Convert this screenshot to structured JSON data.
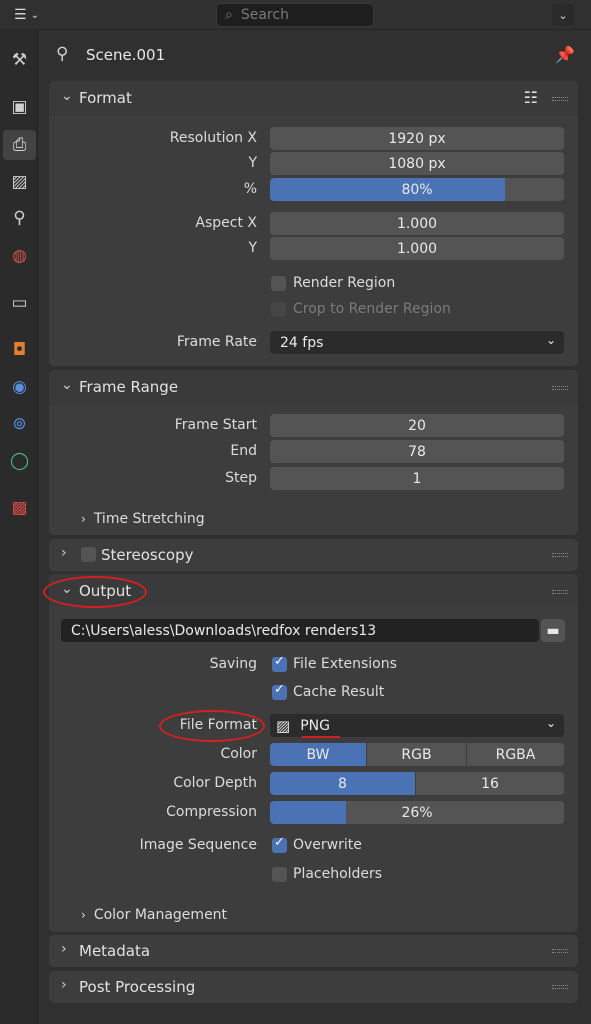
{
  "header": {
    "search_placeholder": "Search",
    "scene_name": "Scene.001"
  },
  "sidebar": {
    "tabs": [
      {
        "name": "tool-tab",
        "icon": "tool-icon"
      },
      {
        "name": "render-tab",
        "icon": "camera-back-icon"
      },
      {
        "name": "output-tab",
        "icon": "printer-icon",
        "active": true
      },
      {
        "name": "view-layer-tab",
        "icon": "image-icon"
      },
      {
        "name": "scene-tab",
        "icon": "scene-icon"
      },
      {
        "name": "world-tab",
        "icon": "world-icon"
      },
      {
        "name": "collection-tab",
        "icon": "box-icon"
      },
      {
        "name": "object-tab",
        "icon": "object-icon"
      },
      {
        "name": "modifiers-tab",
        "icon": "wrench-icon"
      },
      {
        "name": "particles-tab",
        "icon": "particles-icon"
      },
      {
        "name": "physics-tab",
        "icon": "physics-icon"
      },
      {
        "name": "texture-tab",
        "icon": "checker-icon"
      }
    ]
  },
  "format": {
    "title": "Format",
    "res_x_label": "Resolution X",
    "res_x": "1920 px",
    "res_y_label": "Y",
    "res_y": "1080 px",
    "pct_label": "%",
    "pct": "80%",
    "pct_fill": 0.8,
    "aspect_x_label": "Aspect X",
    "aspect_x": "1.000",
    "aspect_y_label": "Y",
    "aspect_y": "1.000",
    "render_region": "Render Region",
    "crop": "Crop to Render Region",
    "frame_rate_label": "Frame Rate",
    "frame_rate": "24 fps"
  },
  "frame_range": {
    "title": "Frame Range",
    "start_label": "Frame Start",
    "start": "20",
    "end_label": "End",
    "end": "78",
    "step_label": "Step",
    "step": "1",
    "time_stretching": "Time Stretching"
  },
  "stereoscopy": {
    "title": "Stereoscopy"
  },
  "output": {
    "title": "Output",
    "path": "C:\\Users\\aless\\Downloads\\redfox renders13",
    "saving_label": "Saving",
    "file_extensions": "File Extensions",
    "cache_result": "Cache Result",
    "file_format_label": "File Format",
    "file_format": "PNG",
    "color_label": "Color",
    "color_options": [
      "BW",
      "RGB",
      "RGBA"
    ],
    "color_selected": "BW",
    "depth_label": "Color Depth",
    "depth_options": [
      "8",
      "16"
    ],
    "depth_selected": "8",
    "compression_label": "Compression",
    "compression": "26%",
    "compression_fill": 0.26,
    "image_sequence_label": "Image Sequence",
    "overwrite": "Overwrite",
    "placeholders": "Placeholders",
    "color_management": "Color Management"
  },
  "metadata": {
    "title": "Metadata"
  },
  "post_processing": {
    "title": "Post Processing"
  },
  "colors": {
    "accent": "#4a72b5",
    "panel": "#3d3d3d",
    "annotation": "#d42020"
  }
}
